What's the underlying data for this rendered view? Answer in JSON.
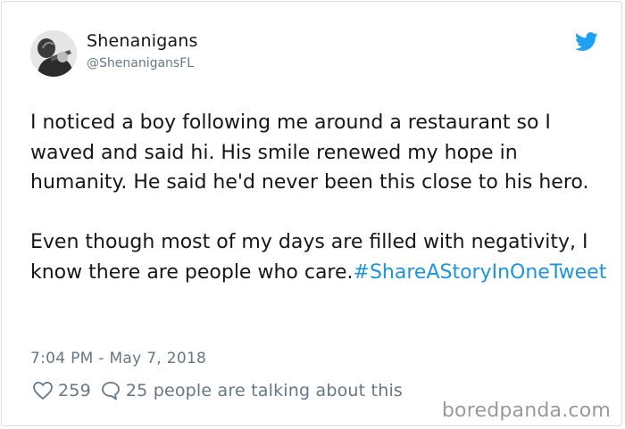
{
  "user": {
    "name": "Shenanigans",
    "handle": "@ShenanigansFL"
  },
  "tweet": {
    "text": "I noticed a boy following me around a restaurant so I waved and said hi. His smile renewed my hope in humanity. He said he'd never been this close to his hero.\n\nEven though most of my days are filled with negativity, I know there are people who care.",
    "hashtag": "#ShareAStoryInOneTweet",
    "timestamp": "7:04 PM - May 7, 2018"
  },
  "stats": {
    "likes": "259",
    "talking": "25 people are talking about this"
  },
  "icons": {
    "logo": "twitter-bird-icon",
    "like": "heart-icon",
    "reply": "speech-bubble-icon"
  },
  "colors": {
    "accent": "#1b95e0",
    "muted": "#657786",
    "text": "#14171a"
  },
  "watermark": "boredpanda.com"
}
